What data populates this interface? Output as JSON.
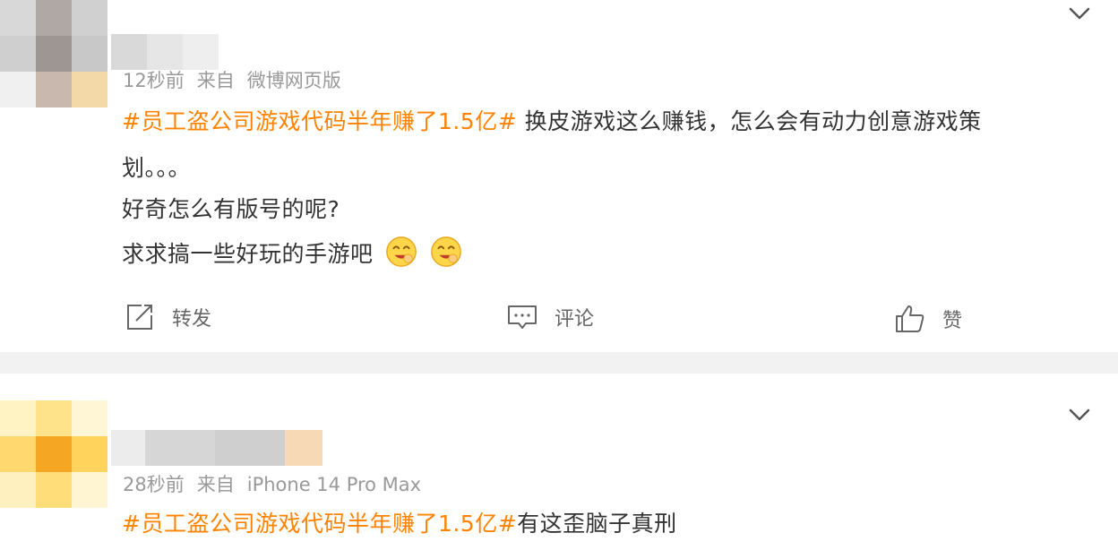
{
  "posts": [
    {
      "meta": {
        "time": "12秒前",
        "from": "来自",
        "source": "微博网页版"
      },
      "topic": "#员工盗公司游戏代码半年赚了1.5亿#",
      "line1_rest": " 换皮游戏这么赚钱，怎么会有动力创意游戏策",
      "line2": "划。。。",
      "line3": "好奇怎么有版号的呢?",
      "line4": "求求搞一些好玩的手游吧",
      "emoji_icons": [
        "grin-emoji-icon",
        "grin-emoji-icon"
      ],
      "actions": {
        "repost": "转发",
        "comment": "评论",
        "like": "赞"
      }
    },
    {
      "meta": {
        "time": "28秒前",
        "from": "来自",
        "source": "iPhone 14 Pro Max"
      },
      "topic": "#员工盗公司游戏代码半年赚了1.5亿#",
      "line1_rest": "有这歪脑子真刑"
    }
  ],
  "colors": {
    "topic": "#ff8200",
    "separator": "#f2f2f2",
    "meta": "#999999"
  }
}
